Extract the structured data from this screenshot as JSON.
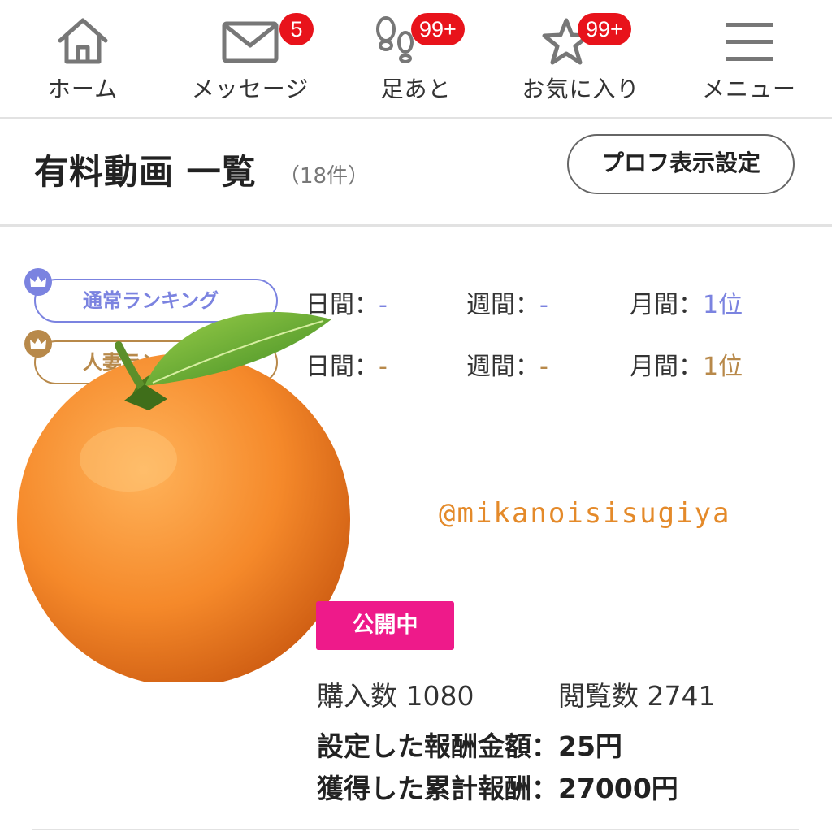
{
  "nav": {
    "items": [
      {
        "icon": "home-icon",
        "label": "ホーム"
      },
      {
        "icon": "mail-icon",
        "label": "メッセージ",
        "badge": "5"
      },
      {
        "icon": "footprints-icon",
        "label": "足あと",
        "badge": "99+"
      },
      {
        "icon": "star-icon",
        "label": "お気に入り",
        "badge": "99+"
      },
      {
        "icon": "menu-icon",
        "label": "メニュー"
      }
    ],
    "badge_color": "#e8131b"
  },
  "header": {
    "title": "有料動画 一覧",
    "count": "（18件）",
    "profile_button": "プロフ表示設定"
  },
  "rankings": [
    {
      "label": "通常ランキング",
      "color": "#7b83e0",
      "daily_label": "日間：",
      "daily_value": "-",
      "weekly_label": "週間：",
      "weekly_value": "-",
      "monthly_label": "月間：",
      "monthly_value": "1位"
    },
    {
      "label": "人妻ランキング",
      "color": "#b8894a",
      "daily_label": "日間：",
      "daily_value": "-",
      "weekly_label": "週間：",
      "weekly_value": "-",
      "monthly_label": "月間：",
      "monthly_value": "1位"
    }
  ],
  "content": {
    "watermark": "@mikanoisisugiya",
    "status": "公開中",
    "status_color": "#ee1a8a",
    "purchases": "購入数 1080",
    "views": "閲覧数 2741",
    "set_reward_label": "設定した報酬金額：",
    "set_reward_value": "25円",
    "total_reward_label": "獲得した累計報酬：",
    "total_reward_value": "27000円"
  }
}
